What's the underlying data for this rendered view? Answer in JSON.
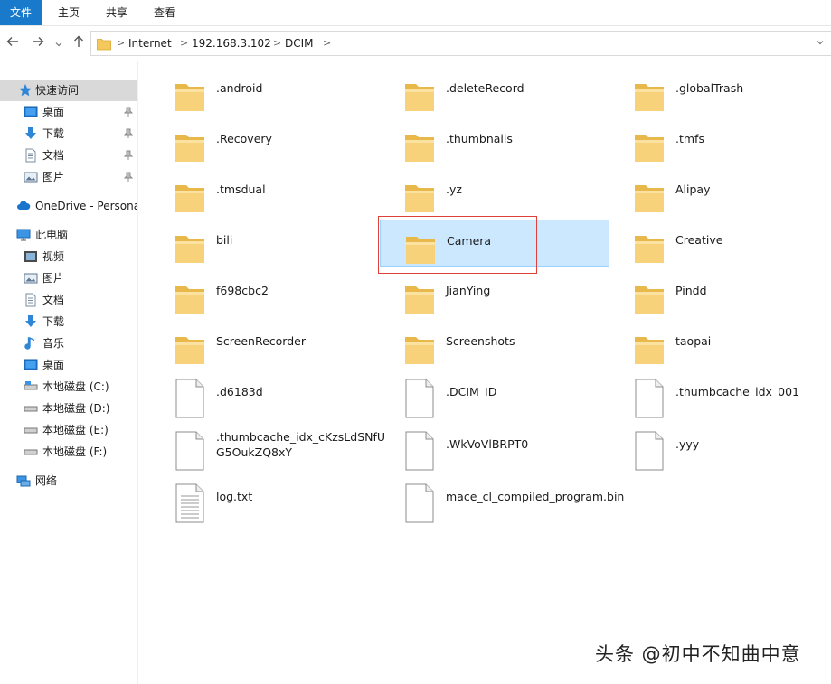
{
  "ribbon": {
    "tabs": [
      "文件",
      "主页",
      "共享",
      "查看"
    ]
  },
  "address": {
    "crumbs": [
      "Internet",
      "192.168.3.102",
      "DCIM"
    ]
  },
  "nav": {
    "quick_access": "快速访问",
    "quick_items": [
      "桌面",
      "下载",
      "文档",
      "图片"
    ],
    "onedrive": "OneDrive - Persona",
    "this_pc": "此电脑",
    "pc_items": [
      "视频",
      "图片",
      "文档",
      "下载",
      "音乐",
      "桌面"
    ],
    "drives": [
      "本地磁盘 (C:)",
      "本地磁盘 (D:)",
      "本地磁盘 (E:)",
      "本地磁盘 (F:)"
    ],
    "network": "网络"
  },
  "items": [
    {
      "name": ".android",
      "type": "folder"
    },
    {
      "name": ".deleteRecord",
      "type": "folder"
    },
    {
      "name": ".globalTrash",
      "type": "folder"
    },
    {
      "name": ".Recovery",
      "type": "folder"
    },
    {
      "name": ".thumbnails",
      "type": "folder"
    },
    {
      "name": ".tmfs",
      "type": "folder"
    },
    {
      "name": ".tmsdual",
      "type": "folder"
    },
    {
      "name": ".yz",
      "type": "folder"
    },
    {
      "name": "Alipay",
      "type": "folder"
    },
    {
      "name": "bili",
      "type": "folder"
    },
    {
      "name": "Camera",
      "type": "folder",
      "selected": true
    },
    {
      "name": "Creative",
      "type": "folder"
    },
    {
      "name": "f698cbc2",
      "type": "folder"
    },
    {
      "name": "JianYing",
      "type": "folder"
    },
    {
      "name": "Pindd",
      "type": "folder"
    },
    {
      "name": "ScreenRecorder",
      "type": "folder"
    },
    {
      "name": "Screenshots",
      "type": "folder"
    },
    {
      "name": "taopai",
      "type": "folder"
    },
    {
      "name": ".d6183d",
      "type": "file"
    },
    {
      "name": ".DCIM_ID",
      "type": "file"
    },
    {
      "name": ".thumbcache_idx_001",
      "type": "file"
    },
    {
      "name": ".thumbcache_idx_cKzsLdSNfUG5OukZQ8xY",
      "type": "file"
    },
    {
      "name": ".WkVoVlBRPT0",
      "type": "file"
    },
    {
      "name": ".yyy",
      "type": "file"
    },
    {
      "name": "log.txt",
      "type": "text"
    },
    {
      "name": "mace_cl_compiled_program.bin",
      "type": "file"
    }
  ],
  "watermark": "头条 @初中不知曲中意",
  "colors": {
    "accent": "#1979ca",
    "selection": "#cce8ff",
    "folder": "#f4c85a",
    "highlight_border": "#e0403a"
  }
}
